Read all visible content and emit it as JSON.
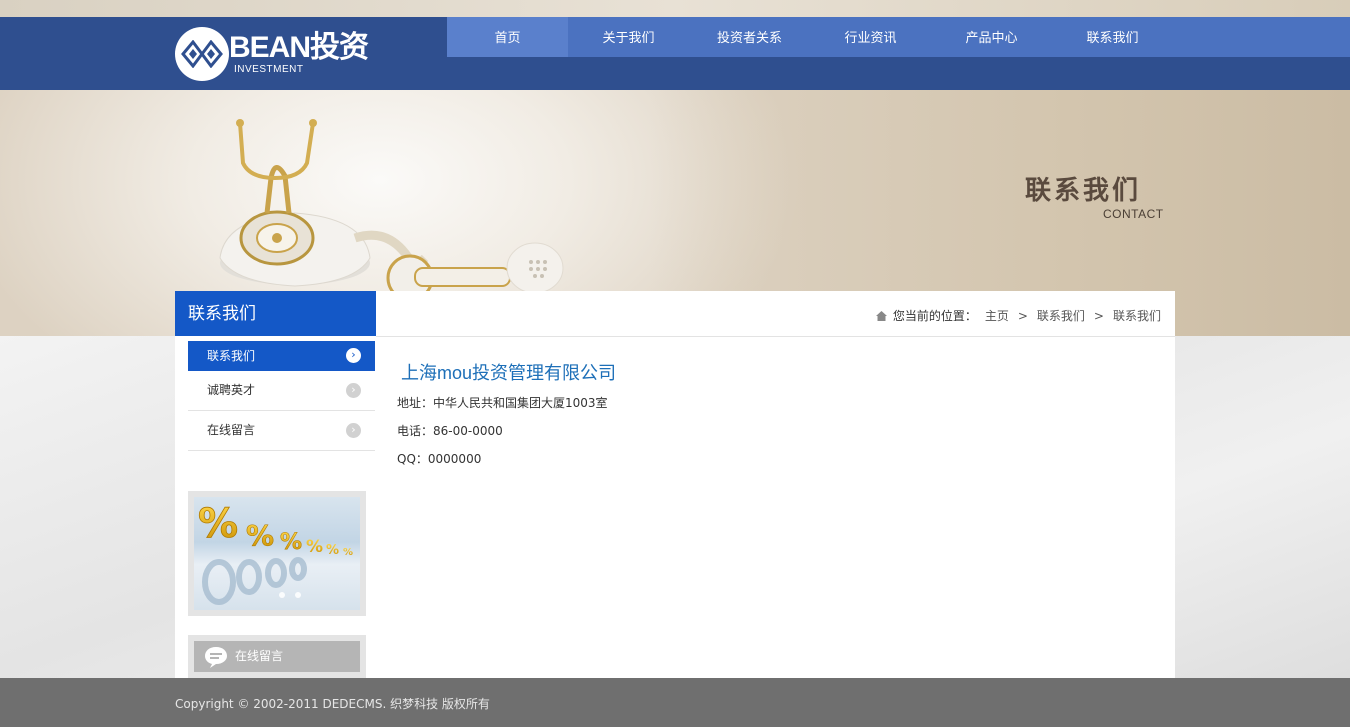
{
  "header": {
    "logo_text": "BEAN投资",
    "logo_sub": "INVESTMENT",
    "nav": [
      {
        "label": "首页"
      },
      {
        "label": "关于我们"
      },
      {
        "label": "投资者关系"
      },
      {
        "label": "行业资讯"
      },
      {
        "label": "产品中心"
      },
      {
        "label": "联系我们"
      }
    ],
    "brand_color": "#2f4f8f",
    "nav_color": "#4b72c0"
  },
  "banner": {
    "title": "联系我们",
    "subtitle": "CONTACT"
  },
  "sidebar": {
    "title": "联系我们",
    "items": [
      {
        "label": "联系我们",
        "active": true
      },
      {
        "label": "诚聘英才",
        "active": false
      },
      {
        "label": "在线留言",
        "active": false
      }
    ],
    "message_button": "在线留言",
    "accent_color": "#1458c7"
  },
  "breadcrumb": {
    "prefix": "您当前的位置：",
    "home": "主页",
    "level1": "联系我们",
    "level2": "联系我们",
    "separator": ">"
  },
  "content": {
    "company": "上海mou投资管理有限公司",
    "address": "地址：中华人民共和国集团大厦1003室",
    "phone": "电话：86-00-0000",
    "qq": "QQ：0000000"
  },
  "footer": {
    "copyright": "Copyright © 2002-2011 DEDECMS. 织梦科技 版权所有"
  }
}
